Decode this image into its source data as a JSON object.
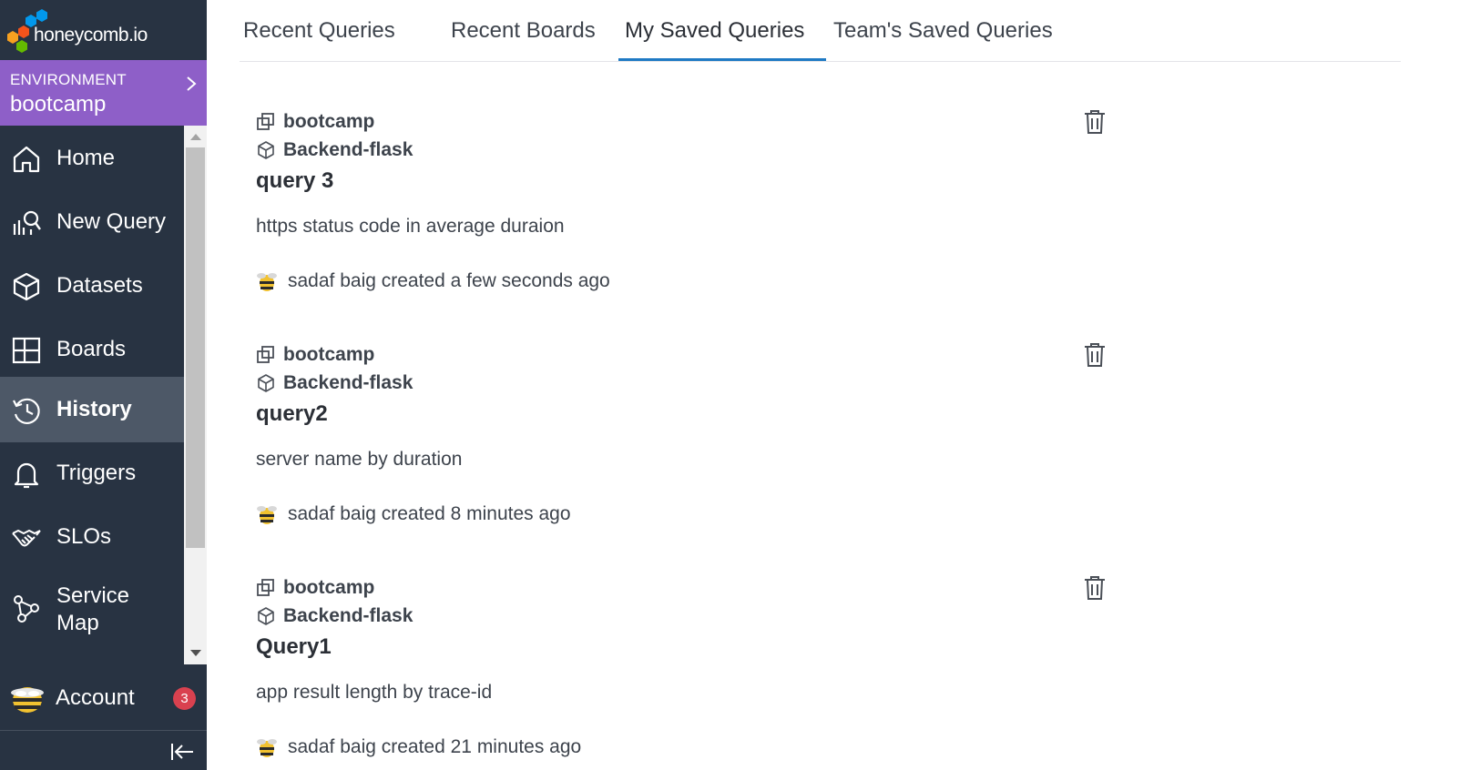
{
  "brand": {
    "wordmark": "honeycomb.io"
  },
  "environment": {
    "label": "ENVIRONMENT",
    "name": "bootcamp"
  },
  "sidebar": {
    "items": [
      {
        "label": "Home",
        "icon": "home-icon"
      },
      {
        "label": "New Query",
        "icon": "new-query-icon"
      },
      {
        "label": "Datasets",
        "icon": "datasets-icon"
      },
      {
        "label": "Boards",
        "icon": "boards-icon"
      },
      {
        "label": "History",
        "icon": "history-icon",
        "active": true
      },
      {
        "label": "Triggers",
        "icon": "bell-icon"
      },
      {
        "label": "SLOs",
        "icon": "handshake-icon"
      },
      {
        "label": "Service Map",
        "icon": "service-map-icon"
      }
    ],
    "account": {
      "label": "Account",
      "badge": "3"
    }
  },
  "tabs": [
    {
      "label": "Recent Queries"
    },
    {
      "label": "Recent Boards"
    },
    {
      "label": "My Saved Queries",
      "active": true
    },
    {
      "label": "Team's Saved Queries"
    }
  ],
  "queries": [
    {
      "environment": "bootcamp",
      "dataset": "Backend-flask",
      "title": "query 3",
      "description": "https status code in average duraion",
      "author": "sadaf baig created a few seconds ago"
    },
    {
      "environment": "bootcamp",
      "dataset": "Backend-flask",
      "title": "query2",
      "description": "server name by duration",
      "author": "sadaf baig created 8 minutes ago"
    },
    {
      "environment": "bootcamp",
      "dataset": "Backend-flask",
      "title": "Query1",
      "description": "app result length by trace-id",
      "author": "sadaf baig created 21 minutes ago"
    }
  ],
  "colors": {
    "sidebar_bg": "#283342",
    "environment_bg": "#8e5fc8",
    "active_nav_bg": "#4d5867",
    "tab_underline": "#1f7ac4",
    "badge": "#d9414f"
  }
}
